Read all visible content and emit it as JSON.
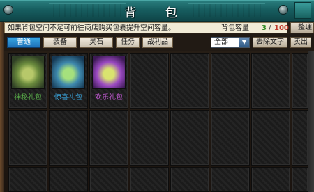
{
  "window": {
    "title": "背 包"
  },
  "infobar": {
    "hint": "如果背包空间不足可前往商店购买包囊提升空间容量。",
    "capacity_label": "背包容量",
    "capacity_used": "3",
    "capacity_sep": "/",
    "capacity_total": "100",
    "sort_button": "整理"
  },
  "tabs": [
    {
      "label": "普通",
      "active": true
    },
    {
      "label": "装备",
      "active": false
    },
    {
      "label": "灵石",
      "active": false
    },
    {
      "label": "任务",
      "active": false
    },
    {
      "label": "战利品",
      "active": false
    }
  ],
  "filter": {
    "selected": "全部"
  },
  "actions": {
    "remove_text": "去除文字",
    "sell": "卖出"
  },
  "items": [
    {
      "name": "神秘礼包",
      "color": "#5ab04a",
      "bg": "#7aa04f"
    },
    {
      "name": "惊喜礼包",
      "color": "#3aa7e0",
      "bg": "#3d86b8"
    },
    {
      "name": "欢乐礼包",
      "color": "#c55ad6",
      "bg": "#8d3fb4"
    }
  ],
  "colors": {
    "title_bar": "#175e60",
    "active_tab": "#2a8ad0"
  }
}
